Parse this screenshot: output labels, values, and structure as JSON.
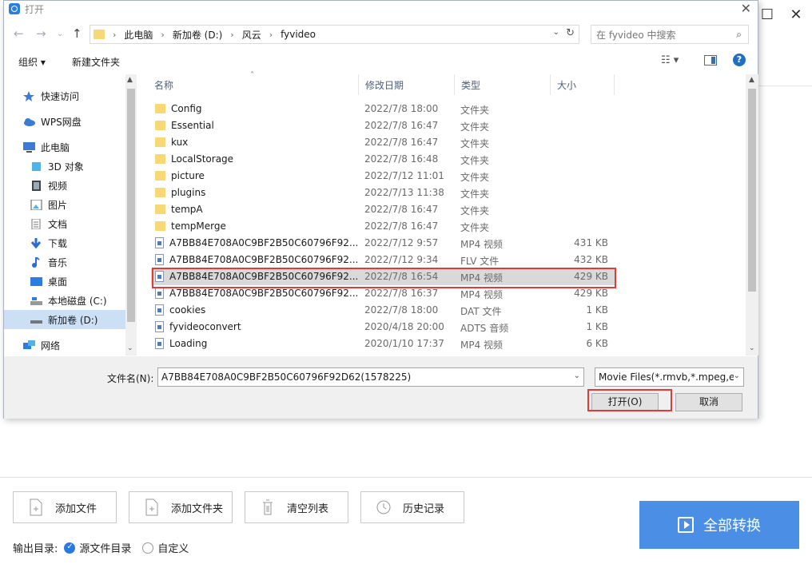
{
  "background_app": {
    "buttons": {
      "add_file": "添加文件",
      "add_folder": "添加文件夹",
      "clear_list": "清空列表",
      "history": "历史记录"
    },
    "convert_all": "全部转换",
    "output_dir_label": "输出目录:",
    "output_options": [
      {
        "label": "源文件目录",
        "selected": true
      },
      {
        "label": "自定义",
        "selected": false
      }
    ],
    "accent_color": "#4a8ee5"
  },
  "dialog": {
    "title": "打开",
    "address": {
      "crumbs": [
        "此电脑",
        "新加卷 (D:)",
        "风云",
        "fyvideo"
      ]
    },
    "search_placeholder": "在 fyvideo 中搜索",
    "toolbar": {
      "organize": "组织 ▾",
      "new_folder": "新建文件夹"
    },
    "sidebar": [
      {
        "label": "快速访问",
        "icon": "star-icon"
      },
      {
        "label": "WPS网盘",
        "icon": "cloud-icon"
      },
      {
        "label": "此电脑",
        "icon": "computer-icon"
      },
      {
        "label": "3D 对象",
        "icon": "cube-icon"
      },
      {
        "label": "视频",
        "icon": "video-icon"
      },
      {
        "label": "图片",
        "icon": "picture-icon"
      },
      {
        "label": "文档",
        "icon": "document-icon"
      },
      {
        "label": "下载",
        "icon": "download-icon"
      },
      {
        "label": "音乐",
        "icon": "music-icon"
      },
      {
        "label": "桌面",
        "icon": "desktop-icon"
      },
      {
        "label": "本地磁盘 (C:)",
        "icon": "drive-icon"
      },
      {
        "label": "新加卷 (D:)",
        "icon": "drive-icon",
        "selected": true
      },
      {
        "label": "网络",
        "icon": "network-icon"
      }
    ],
    "columns": {
      "name": "名称",
      "date": "修改日期",
      "type": "类型",
      "size": "大小"
    },
    "files": [
      {
        "name": "Config",
        "date": "2022/7/8 18:00",
        "type": "文件夹",
        "size": "",
        "kind": "folder"
      },
      {
        "name": "Essential",
        "date": "2022/7/8 16:47",
        "type": "文件夹",
        "size": "",
        "kind": "folder"
      },
      {
        "name": "kux",
        "date": "2022/7/8 16:47",
        "type": "文件夹",
        "size": "",
        "kind": "folder"
      },
      {
        "name": "LocalStorage",
        "date": "2022/7/8 16:48",
        "type": "文件夹",
        "size": "",
        "kind": "folder"
      },
      {
        "name": "picture",
        "date": "2022/7/12 11:01",
        "type": "文件夹",
        "size": "",
        "kind": "folder"
      },
      {
        "name": "plugins",
        "date": "2022/7/13 11:38",
        "type": "文件夹",
        "size": "",
        "kind": "folder"
      },
      {
        "name": "tempA",
        "date": "2022/7/8 16:47",
        "type": "文件夹",
        "size": "",
        "kind": "folder"
      },
      {
        "name": "tempMerge",
        "date": "2022/7/8 16:47",
        "type": "文件夹",
        "size": "",
        "kind": "folder"
      },
      {
        "name": "A7BB84E708A0C9BF2B50C60796F92...",
        "date": "2022/7/12 9:57",
        "type": "MP4 视频",
        "size": "431 KB",
        "kind": "file"
      },
      {
        "name": "A7BB84E708A0C9BF2B50C60796F92...",
        "date": "2022/7/12 9:34",
        "type": "FLV 文件",
        "size": "432 KB",
        "kind": "file"
      },
      {
        "name": "A7BB84E708A0C9BF2B50C60796F92...",
        "date": "2022/7/8 16:54",
        "type": "MP4 视频",
        "size": "429 KB",
        "kind": "file",
        "selected": true
      },
      {
        "name": "A7BB84E708A0C9BF2B50C60796F92...",
        "date": "2022/7/8 16:37",
        "type": "MP4 视频",
        "size": "429 KB",
        "kind": "file"
      },
      {
        "name": "cookies",
        "date": "2022/7/8 18:00",
        "type": "DAT 文件",
        "size": "1 KB",
        "kind": "file"
      },
      {
        "name": "fyvideoconvert",
        "date": "2020/4/18 20:00",
        "type": "ADTS 音频",
        "size": "1 KB",
        "kind": "file"
      },
      {
        "name": "Loading",
        "date": "2020/1/10 17:37",
        "type": "MP4 视频",
        "size": "6 KB",
        "kind": "file"
      }
    ],
    "filename_label": "文件名(N):",
    "filename_value": "A7BB84E708A0C9BF2B50C60796F92D62(1578225)",
    "filter_value": "Movie Files(*.rmvb,*.mpeg,et",
    "open_button": "打开(O)",
    "cancel_button": "取消",
    "highlight_color": "#e03a3a"
  }
}
